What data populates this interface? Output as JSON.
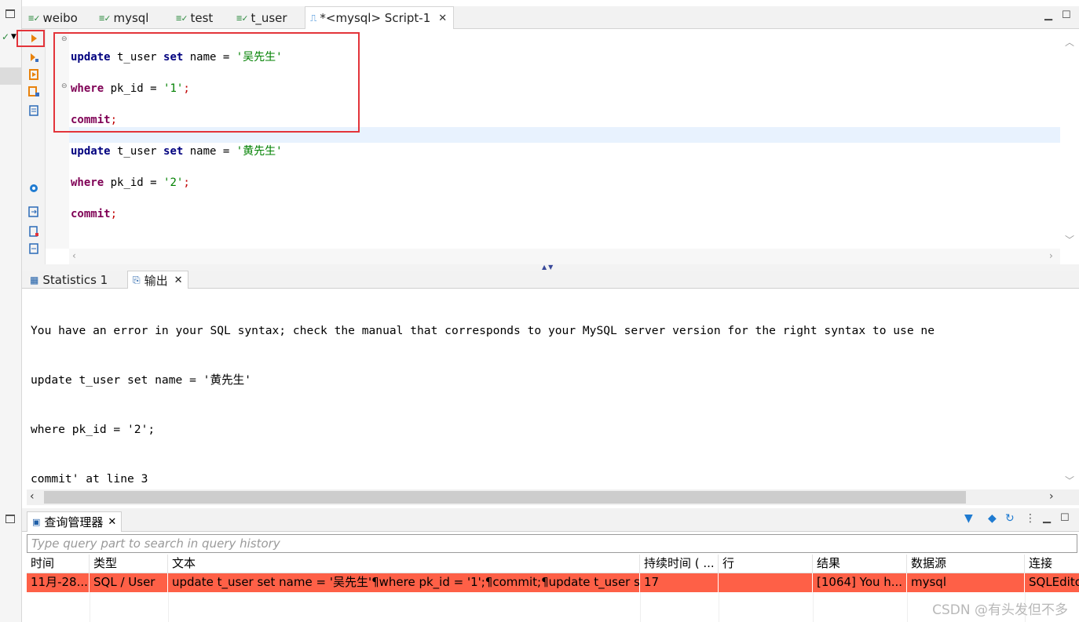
{
  "editor_tabs": [
    {
      "label": "weibo",
      "icon": "sql-editor-icon"
    },
    {
      "label": "mysql",
      "icon": "sql-editor-icon"
    },
    {
      "label": "test",
      "icon": "sql-editor-icon"
    },
    {
      "label": "t_user",
      "icon": "sql-editor-icon"
    },
    {
      "label": "*<mysql> Script-1",
      "icon": "script-icon",
      "active": true
    }
  ],
  "editor": {
    "lines": [
      {
        "kw1": "update",
        "mid1": " t_user ",
        "kw2": "set",
        "mid2": " name = ",
        "str": "'吴先生'",
        "end": ""
      },
      {
        "kw1": "where",
        "mid1": " pk_id = ",
        "kw2": "",
        "mid2": "",
        "str": "'1'",
        "end": ";"
      },
      {
        "kw1": "commit",
        "mid1": "",
        "kw2": "",
        "mid2": "",
        "str": "",
        "end": ";"
      },
      {
        "kw1": "update",
        "mid1": " t_user ",
        "kw2": "set",
        "mid2": " name = ",
        "str": "'黄先生'",
        "end": ""
      },
      {
        "kw1": "where",
        "mid1": " pk_id = ",
        "kw2": "",
        "mid2": "",
        "str": "'2'",
        "end": ";"
      },
      {
        "kw1": "commit",
        "mid1": "",
        "kw2": "",
        "mid2": "",
        "str": "",
        "end": ";"
      }
    ]
  },
  "output_tabs": [
    {
      "label": "Statistics 1",
      "icon": "grid-icon"
    },
    {
      "label": "输出",
      "icon": "output-icon",
      "active": true
    }
  ],
  "output_lines": [
    "You have an error in your SQL syntax; check the manual that corresponds to your MySQL server version for the right syntax to use ne",
    "update t_user set name = '黄先生'",
    "where pk_id = '2';",
    "commit' at line 3"
  ],
  "query_manager": {
    "tab_label": "查询管理器",
    "search_placeholder": "Type query part to search in query history",
    "columns": [
      "时间",
      "类型",
      "文本",
      "持续时间 ( ...",
      "行",
      "结果",
      "数据源",
      "连接"
    ],
    "row": [
      "11月-28...",
      "SQL / User",
      "update t_user set name = '吴先生'¶where pk_id = '1';¶commit;¶update t_user se...",
      "17",
      "",
      "[1064] You h...",
      "mysql",
      "SQLEdito"
    ]
  },
  "watermark": "CSDN @有头发但不多",
  "colors": {
    "error_row": "#fe6047",
    "highlight_box": "#e3343a",
    "current_line": "#e8f2fe"
  }
}
